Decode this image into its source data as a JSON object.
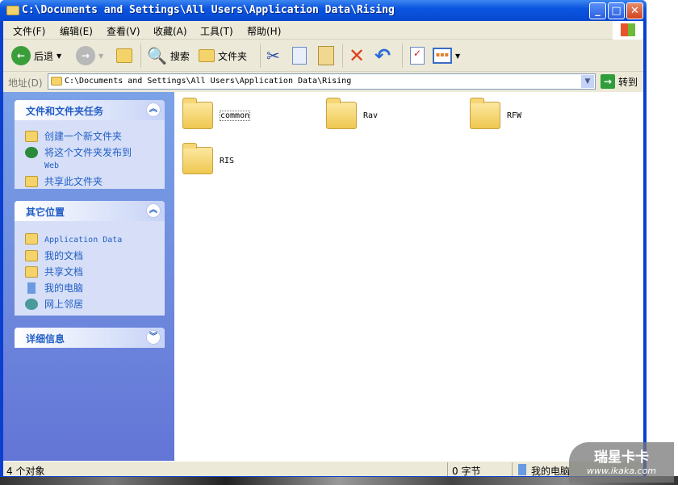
{
  "window": {
    "title": "C:\\Documents and Settings\\All Users\\Application Data\\Rising",
    "minimize": "_",
    "maximize": "□",
    "close": "✕"
  },
  "menu": [
    "文件(F)",
    "编辑(E)",
    "查看(V)",
    "收藏(A)",
    "工具(T)",
    "帮助(H)"
  ],
  "toolbar": {
    "back": "后退",
    "search": "搜索",
    "folders": "文件夹"
  },
  "address": {
    "label": "地址(D)",
    "value": "C:\\Documents and Settings\\All Users\\Application Data\\Rising",
    "go": "转到"
  },
  "sidebar": {
    "tasks": {
      "title": "文件和文件夹任务",
      "items": [
        "创建一个新文件夹",
        "将这个文件夹发布到",
        "Web",
        "共享此文件夹"
      ]
    },
    "places": {
      "title": "其它位置",
      "items": [
        "Application Data",
        "我的文档",
        "共享文档",
        "我的电脑",
        "网上邻居"
      ]
    },
    "details": {
      "title": "详细信息"
    }
  },
  "files": [
    "common",
    "Rav",
    "RFW",
    "RIS"
  ],
  "status": {
    "objects": "4 个对象",
    "size": "0 字节",
    "location": "我的电脑"
  },
  "watermark": {
    "brand": "瑞星卡卡",
    "url": "www.ikaka.com"
  }
}
